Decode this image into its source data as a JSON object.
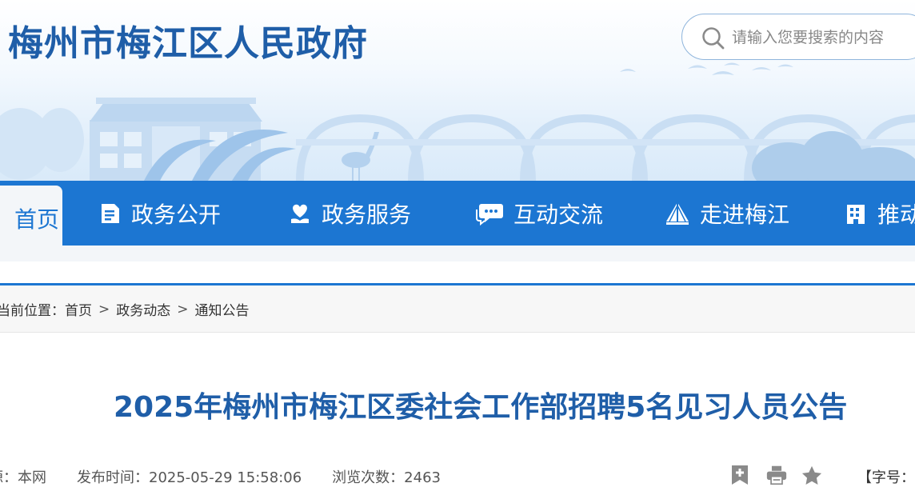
{
  "header": {
    "site_title": "梅州市梅江区人民政府",
    "search": {
      "placeholder": "请输入您要搜索的内容",
      "value": ""
    }
  },
  "nav": {
    "items": [
      {
        "label": "首页",
        "icon": "home",
        "active": true
      },
      {
        "label": "政务公开",
        "icon": "document-icon"
      },
      {
        "label": "政务服务",
        "icon": "heart-hand-icon"
      },
      {
        "label": "互动交流",
        "icon": "chat-icon"
      },
      {
        "label": "走进梅江",
        "icon": "bridge-icon"
      },
      {
        "label": "推动",
        "icon": "building-icon"
      }
    ]
  },
  "breadcrumb": {
    "prefix": "当前位置：",
    "items": [
      "首页",
      "政务动态",
      "通知公告"
    ],
    "separator": ">"
  },
  "article": {
    "title": "2025年梅州市梅江区委社会工作部招聘5名见习人员公告",
    "meta": {
      "source": "源：本网",
      "published": "发布时间：2025-05-29 15:58:06",
      "views": "浏览次数：2463"
    },
    "font_size_label": "【字号："
  },
  "colors": {
    "primary_blue": "#1c76d2",
    "title_blue": "#1f5ea8",
    "scenery_blue": "#c9def3"
  }
}
